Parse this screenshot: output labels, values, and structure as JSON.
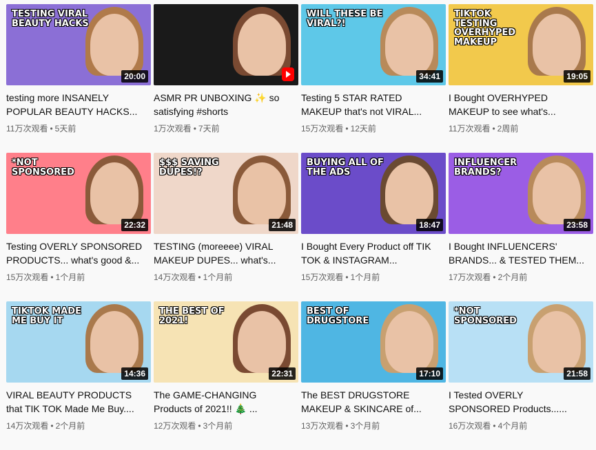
{
  "videos": [
    {
      "title": "testing more INSANELY POPULAR BEAUTY HACKS...",
      "views": "11万次观看",
      "age": "5天前",
      "duration": "20:00",
      "overlay": "testing viral BEAUTY HACKS",
      "bg": "#8b6fd6",
      "hair": "#b07a4a"
    },
    {
      "title": "ASMR PR UNBOXING ✨ so satisfying #shorts",
      "views": "1万次观看",
      "age": "7天前",
      "duration": "",
      "overlay": "",
      "bg": "#1a1a1a",
      "hair": "#7a4a32",
      "shorts": true
    },
    {
      "title": "Testing 5 STAR RATED MAKEUP that's not VIRAL...",
      "views": "15万次观看",
      "age": "12天前",
      "duration": "34:41",
      "overlay": "WILL THESE BE VIRAL?!",
      "bg": "#5ec8e8",
      "hair": "#b88a5a"
    },
    {
      "title": "I Bought OVERHYPED MAKEUP to see what's...",
      "views": "11万次观看",
      "age": "2周前",
      "duration": "19:05",
      "overlay": "TikTok TESTING OVERHYPED MAKEUP",
      "bg": "#f2c94c",
      "hair": "#a9794c"
    },
    {
      "title": "Testing OVERLY SPONSORED PRODUCTS... what's good &...",
      "views": "15万次观看",
      "age": "1个月前",
      "duration": "22:32",
      "overlay": "*NOT SPONSORED",
      "bg": "#ff7f8a",
      "hair": "#8a5a3a"
    },
    {
      "title": "TESTING (moreeee) VIRAL MAKEUP DUPES... what's...",
      "views": "14万次观看",
      "age": "1个月前",
      "duration": "21:48",
      "overlay": "$$$ SAVING DUPES!?",
      "bg": "#efd7c9",
      "hair": "#8a5a3a"
    },
    {
      "title": "I Bought Every Product off TIK TOK & INSTAGRAM...",
      "views": "15万次观看",
      "age": "1个月前",
      "duration": "18:47",
      "overlay": "BUYING ALL OF THE ADS",
      "bg": "#6b4cc9",
      "hair": "#6a4a32"
    },
    {
      "title": "I Bought INFLUENCERS' BRANDS... & TESTED THEM...",
      "views": "17万次观看",
      "age": "2个月前",
      "duration": "23:58",
      "overlay": "INFLUENCER BRANDS?",
      "bg": "#9b5de5",
      "hair": "#b88a5a"
    },
    {
      "title": "VIRAL BEAUTY PRODUCTS that TIK TOK Made Me Buy....",
      "views": "14万次观看",
      "age": "2个月前",
      "duration": "14:36",
      "overlay": "TikTok MADE ME BUY IT",
      "bg": "#a6d8f0",
      "hair": "#a9794c"
    },
    {
      "title": "The GAME-CHANGING Products of 2021!! 🎄 ...",
      "views": "12万次观看",
      "age": "3个月前",
      "duration": "22:31",
      "overlay": "THE BEST OF 2021!",
      "bg": "#f6e3b4",
      "hair": "#7a4a32"
    },
    {
      "title": "The BEST DRUGSTORE MAKEUP & SKINCARE of...",
      "views": "13万次观看",
      "age": "3个月前",
      "duration": "17:10",
      "overlay": "BEST OF DRUGSTORE",
      "bg": "#4fb6e3",
      "hair": "#c8a070"
    },
    {
      "title": "I Tested OVERLY SPONSORED Products......",
      "views": "16万次观看",
      "age": "4个月前",
      "duration": "21:58",
      "overlay": "*NOT SPONSORED",
      "bg": "#b8e0f5",
      "hair": "#c8a070"
    }
  ]
}
